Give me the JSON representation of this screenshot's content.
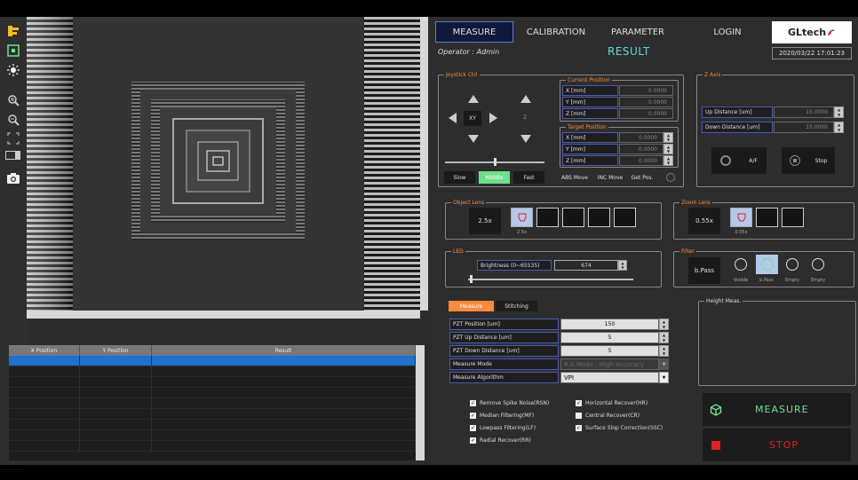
{
  "nav": {
    "measure": "MEASURE",
    "calibration": "CALIBRATION",
    "parameter": "PARAMETER",
    "login": "LOGIN"
  },
  "brand": "GLtech",
  "operator": "Operator : Admin",
  "result_label": "RESULT",
  "datetime": "2020/03/22 17:01:23",
  "results_table": {
    "columns": [
      "X Position",
      "Y Position",
      "Result"
    ]
  },
  "joystick": {
    "title": "Joystick Ctrl",
    "xy": "XY",
    "z": "Z",
    "speed_labels": [
      "Slow",
      "Middle",
      "Fast"
    ],
    "buttons": [
      "ABS Move",
      "INC Move",
      "Get Pos."
    ]
  },
  "current_position": {
    "title": "Current Position",
    "rows": [
      {
        "label": "X [mm]",
        "value": "0.0000"
      },
      {
        "label": "Y [mm]",
        "value": "0.0000"
      },
      {
        "label": "Z [mm]",
        "value": "0.0000"
      }
    ]
  },
  "target_position": {
    "title": "Target Position",
    "rows": [
      {
        "label": "X [mm]",
        "value": "0.0000"
      },
      {
        "label": "Y [mm]",
        "value": "0.0000"
      },
      {
        "label": "Z [mm]",
        "value": "0.0000"
      }
    ]
  },
  "z_axis": {
    "title": "Z Axis",
    "up_label": "Up Distance [um]",
    "up_value": "15.0000",
    "down_label": "Down Distance [um]",
    "down_value": "15.0000",
    "af": "A/F",
    "stop": "Stop"
  },
  "object_lens": {
    "title": "Object Lens",
    "current": "2.5x",
    "slot1": "2.5x"
  },
  "zoom_lens": {
    "title": "Zoom Lens",
    "current": "0.55x",
    "slot1": "0.55x"
  },
  "led": {
    "title": "LED",
    "brightness_label": "Brightness (0~65535)",
    "brightness_value": "674",
    "slider_fraction": 0.01
  },
  "filter": {
    "title": "Filter",
    "current": "b.Pass",
    "items": [
      "Visible",
      "b.Pass",
      "Empty",
      "Empty"
    ]
  },
  "tabs": {
    "measure": "Measure",
    "stitching": "Stitching"
  },
  "params": [
    {
      "label": "PZT Position [um]",
      "value": "150"
    },
    {
      "label": "PZT Up Distance [um]",
      "value": "5"
    },
    {
      "label": "PZT Down Distance [um]",
      "value": "5"
    },
    {
      "label": "Measure Mode",
      "value": "R.A Mode : High Accuracy"
    },
    {
      "label": "Measure Algorithm",
      "value": "VPI"
    }
  ],
  "options_left": [
    "Remove Spike Noise(RSN)",
    "Median Filtering(MF)",
    "Lowpass Filtering(LF)",
    "Radial Recover(RR)"
  ],
  "options_right": [
    "Horizontal Recover(HR)",
    "Central Recover(CR)",
    "Surface Slop Correction(SSC)"
  ],
  "height_meas": "Height Meas.",
  "actions": {
    "measure": "MEASURE",
    "stop": "STOP"
  },
  "colors": {
    "accent_orange": "#ff8a3c",
    "measure_green": "#6ee08a",
    "stop_red": "#e02020",
    "result_cyan": "#5fd6e0",
    "selection_blue": "#1d6fd1"
  }
}
